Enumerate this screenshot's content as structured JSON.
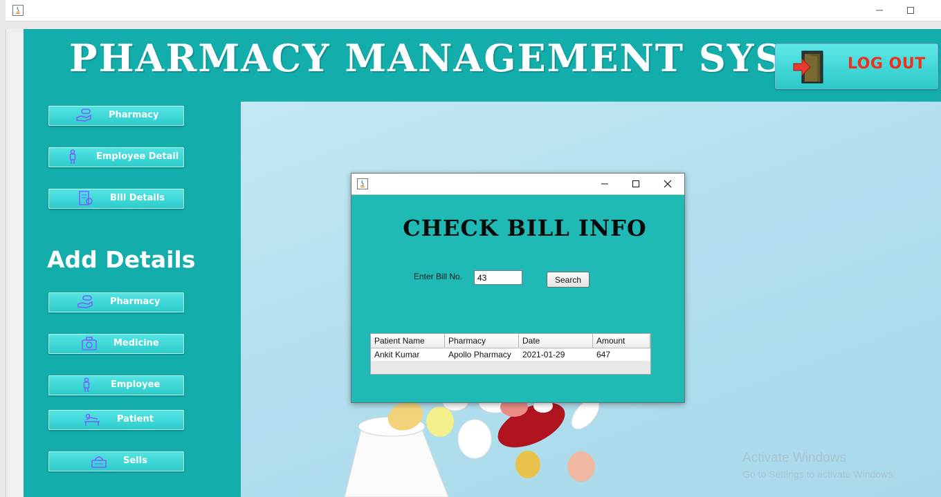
{
  "app": {
    "title": "PHARMACY MANAGEMENT SYSTEM",
    "logout_label": "LOG OUT"
  },
  "sidebar": {
    "top_items": [
      {
        "label": "Pharmacy",
        "icon": "pharmacy-hand-icon"
      },
      {
        "label": "Employee Detail",
        "icon": "person-icon"
      },
      {
        "label": "Bill Details",
        "icon": "bill-icon"
      }
    ],
    "section_heading": "Add Details",
    "add_items": [
      {
        "label": "Pharmacy",
        "icon": "pharmacy-hand-icon"
      },
      {
        "label": "Medicine",
        "icon": "medical-kit-icon"
      },
      {
        "label": "Employee",
        "icon": "person-icon"
      },
      {
        "label": "Patient",
        "icon": "patient-bed-icon"
      },
      {
        "label": "Sells",
        "icon": "cash-register-icon"
      }
    ]
  },
  "dialog": {
    "heading": "CHECK BILL INFO",
    "bill_label": "Enter Bill No.",
    "bill_value": "43",
    "search_label": "Search",
    "table": {
      "columns": [
        "Patient Name",
        "Pharmacy",
        "Date",
        "Amount"
      ],
      "rows": [
        [
          "Ankit Kumar",
          "Apollo Pharmacy",
          "2021-01-29",
          "647"
        ]
      ]
    }
  },
  "watermark": {
    "title": "Activate Windows",
    "subtitle": "Go to Settings to activate Windows."
  },
  "colors": {
    "frame": "#13adac",
    "dialog": "#1fbab5",
    "button": "#2dcccc",
    "logout_text": "#f0301c"
  }
}
